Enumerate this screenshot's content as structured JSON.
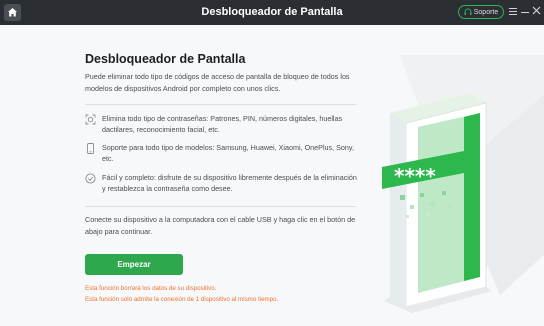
{
  "titlebar": {
    "title": "Desbloqueador de Pantalla",
    "support_label": "Soporte",
    "icons": [
      "home-icon",
      "support-icon",
      "menu-icon",
      "minimize-icon",
      "close-icon"
    ]
  },
  "main": {
    "title": "Desbloqueador de Pantalla",
    "intro": "Puede eliminar todo tipo de códigos de acceso de pantalla de bloqueo de todos los modelos de dispositivos Android por completo con unos clics.",
    "features": [
      {
        "icon": "face-scan-icon",
        "text": "Elimina todo tipo de contraseñas: Patrones, PIN, números digitales, huellas dactilares, reconocimiento facial, etc."
      },
      {
        "icon": "phone-icon",
        "text": "Soporte para todo tipo de modelos: Samsung, Huawei, Xiaomi, OnePlus, Sony, etc."
      },
      {
        "icon": "check-circle-icon",
        "text": "Fácil y completo: disfrute de su dispositivo libremente después de la eliminación y restablezca la contraseña como desee."
      }
    ],
    "instruction": "Conecte su dispositivo a la computadora con el cable USB y haga clic en el botón de abajo para continuar.",
    "start_button": "Empezar",
    "warnings": [
      "Esta función borrará los datos de su dispositivo.",
      "Esta función solo admite la conexión de 1 dispositivo al mismo tiempo."
    ]
  },
  "illustration": {
    "password_mask": "****",
    "accent_color": "#2db84d"
  },
  "colors": {
    "titlebar_bg": "#2b2f33",
    "accent": "#2ea74d",
    "warning": "#ef7330"
  }
}
